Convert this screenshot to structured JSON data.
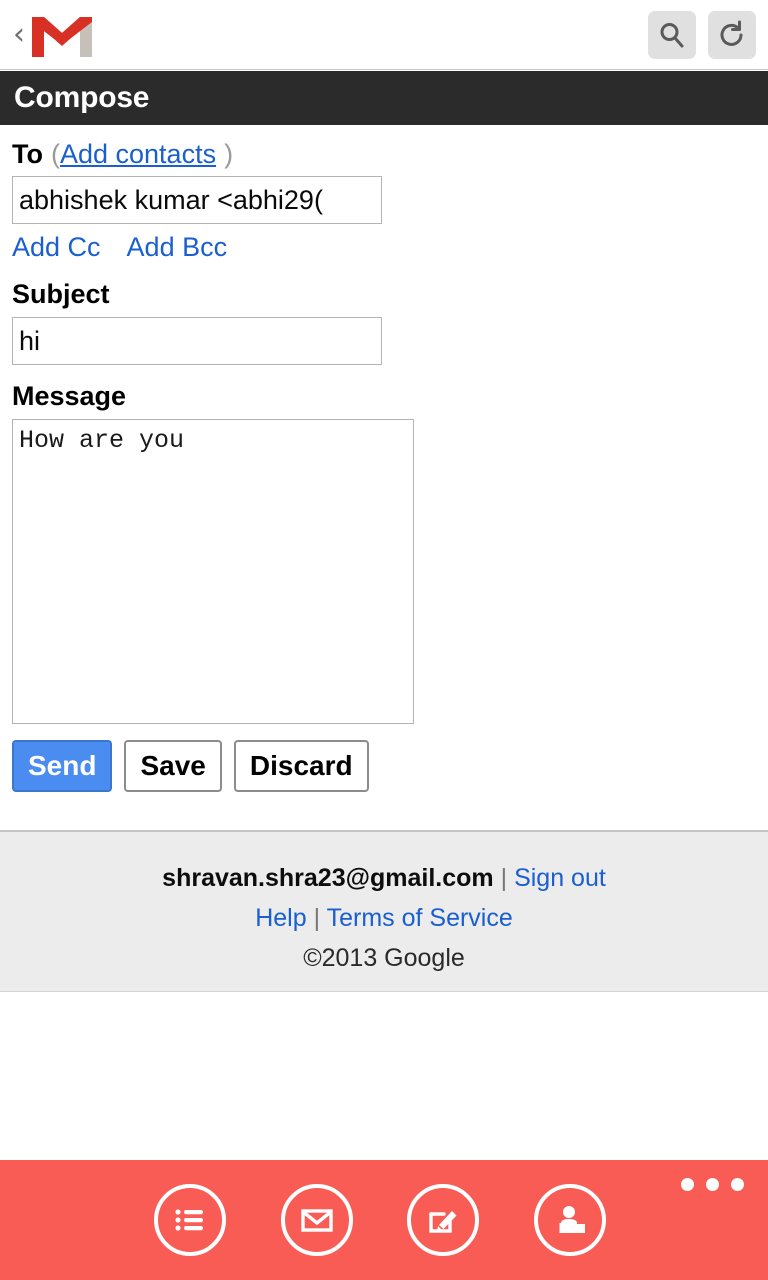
{
  "topbar": {
    "back_icon": "back-chevron-icon",
    "logo": "gmail-logo",
    "search_icon": "search-icon",
    "reload_icon": "reload-icon"
  },
  "title_bar": {
    "title": "Compose"
  },
  "compose": {
    "to": {
      "label": "To",
      "paren_open": "(",
      "add_contacts_link": "Add contacts",
      "paren_close": ")",
      "value": "abhishek kumar <abhi29(",
      "placeholder": ""
    },
    "cc_link": "Add Cc",
    "bcc_link": "Add Bcc",
    "subject": {
      "label": "Subject",
      "value": "hi",
      "placeholder": ""
    },
    "message": {
      "label": "Message",
      "value": "How are you",
      "placeholder": ""
    },
    "buttons": {
      "send": "Send",
      "save": "Save",
      "discard": "Discard"
    }
  },
  "footer": {
    "account": "shravan.shra23@gmail.com",
    "separator": "|",
    "sign_out": "Sign out",
    "help": "Help",
    "terms": "Terms of Service",
    "copyright": "©2013 Google"
  },
  "bottom_bar": {
    "icons": [
      {
        "name": "labels-list-icon"
      },
      {
        "name": "mail-envelope-icon"
      },
      {
        "name": "compose-pencil-icon"
      },
      {
        "name": "contacts-person-icon"
      }
    ],
    "overflow": "overflow-menu-icon"
  },
  "colors": {
    "toolbar_red": "#f85c55",
    "title_bar_dark": "#2b2b2b",
    "link_blue": "#1a5fd0",
    "send_blue": "#4a8cf0",
    "footer_gray": "#ececec"
  }
}
